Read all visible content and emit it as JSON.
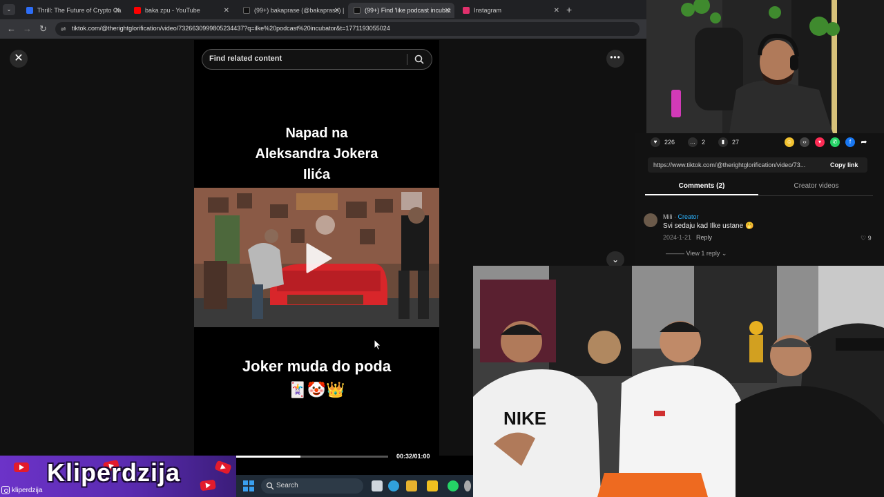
{
  "browser": {
    "tabs": [
      {
        "label": "Thrill: The Future of Crypto Ca",
        "favicon_color": "#2d6df6",
        "active": false
      },
      {
        "label": "baka zpu - YouTube",
        "favicon_color": "#ff0000",
        "active": false
      },
      {
        "label": "(99+) bakaprase (@bakaprase) |",
        "favicon_color": "#111111",
        "active": false
      },
      {
        "label": "(99+) Find 'like podcast incubat",
        "favicon_color": "#111111",
        "active": true
      },
      {
        "label": "Instagram",
        "favicon_color": "#e1306c",
        "active": false
      }
    ],
    "new_tab_symbol": "+",
    "url": "tiktok.com/@therightglorification/video/7326630999805234437?q=ilke%20podcast%20incubator&t=1771193055024"
  },
  "viewer": {
    "close_symbol": "✕",
    "more_symbol": "•••",
    "down_symbol": "⌄",
    "search_placeholder": "Find related content",
    "headline": "Napad na Aleksandra Jokera Ilića",
    "caption": "Joker muda do poda",
    "emojis": "🃏🤡👑",
    "time_label": "00:32/01:00",
    "progress_percent": 53
  },
  "panel": {
    "likes": "226",
    "comments": "2",
    "saves": "27",
    "share_colors": [
      "#f2c230",
      "#444444",
      "#fe2c55",
      "#25d366",
      "#1877f2"
    ],
    "link_url": "https://www.tiktok.com/@therightglorification/video/73...",
    "copy_link_label": "Copy link",
    "tab_comments": "Comments (2)",
    "tab_creator": "Creator videos",
    "comment": {
      "author": "Mili",
      "creator_tag": "Creator",
      "text": "Svi sedaju kad Ilke ustane 🤭",
      "date": "2024-1-21",
      "reply_label": "Reply",
      "likes": "9",
      "view_replies": "View 1 reply"
    }
  },
  "taskbar": {
    "search_label": "Search",
    "apps": [
      "#2b7ce9",
      "#31a1dc",
      "#e6b22e",
      "#f0c020",
      "#25d366",
      "#aaaaaa"
    ]
  },
  "overlay": {
    "title": "Kliperdzija",
    "handle": "kliperdzija"
  }
}
